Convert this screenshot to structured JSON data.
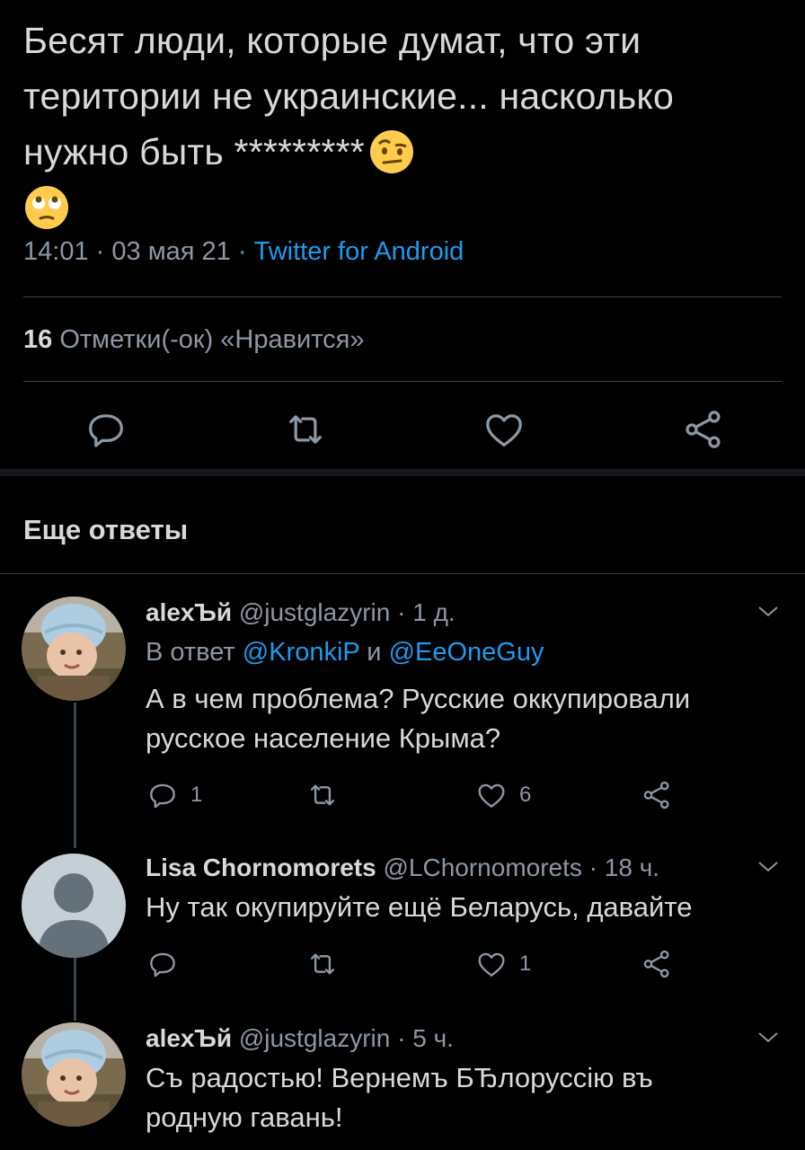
{
  "tweet": {
    "text": "Бесят люди, которые думат, что эти територии не украинские... насколько нужно быть *********",
    "time": "14:01",
    "sep1": "·",
    "date": "03 мая 21",
    "sep2": "·",
    "source": "Twitter for Android",
    "likes_count": "16",
    "likes_label": "Отметки(-ок) «Нравится»",
    "emoji": [
      "face-with-raised-eyebrow-icon",
      "face-with-rolling-eyes-icon"
    ]
  },
  "section_title": "Еще ответы",
  "replies": [
    {
      "name": "alexЪй",
      "handle": "@justglazyrin",
      "sep": "·",
      "time": "1 д.",
      "reply_prefix": "В ответ",
      "mention1": "@KronkiP",
      "conj": "и",
      "mention2": "@EeOneGuy",
      "text": "А в чем проблема? Русские оккупировали русское население Крыма?",
      "replies_count": "1",
      "likes_count": "6"
    },
    {
      "name": "Lisa Chornomorets",
      "handle": "@LChornomorets",
      "sep": "·",
      "time": "18 ч.",
      "text": "Ну так окупируйте ещё Беларусь, давайте",
      "replies_count": "",
      "likes_count": "1"
    },
    {
      "name": "alexЪй",
      "handle": "@justglazyrin",
      "sep": "·",
      "time": "5 ч.",
      "text": "Съ радостью! Вернемъ БЂлоруссію въ родную гавань!"
    }
  ],
  "colors": {
    "background": "#000000",
    "text": "#d9d9d9",
    "secondary": "#8b98a5",
    "accent": "#1d9bf0",
    "divider": "#38444d"
  }
}
